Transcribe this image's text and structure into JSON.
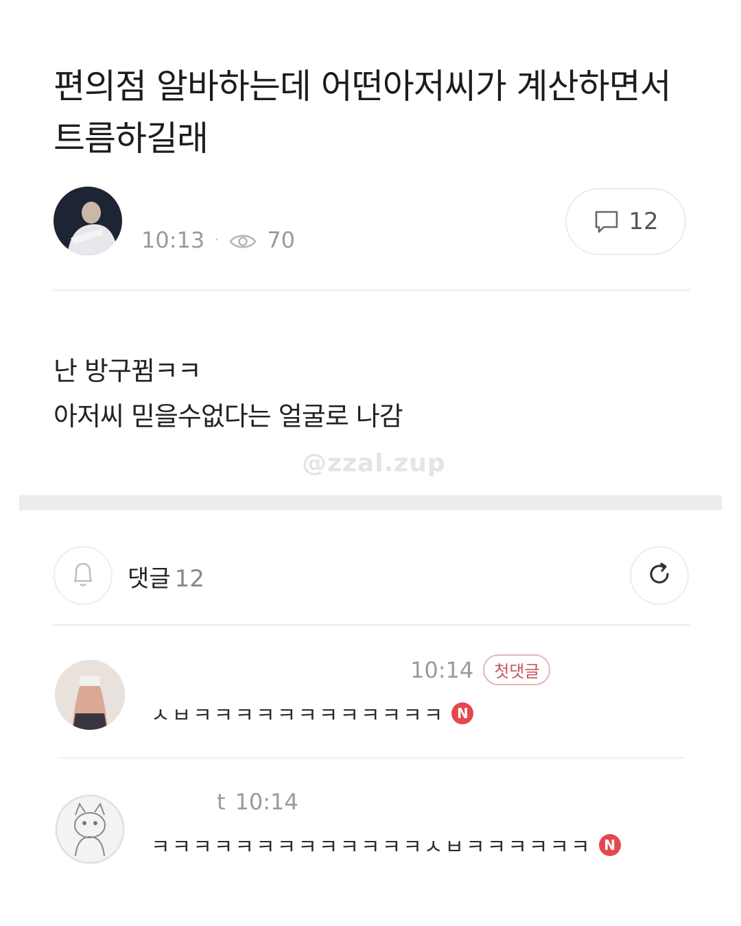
{
  "post": {
    "title": "편의점 알바하는데 어떤아저씨가 계산하면서 트름하길래",
    "time": "10:13",
    "views": "70",
    "comment_count": "12",
    "body_lines": [
      "난 방구뀜ㅋㅋ",
      "아저씨 믿을수없다는 얼굴로 나감"
    ],
    "watermark": "@zzal.zup"
  },
  "comments_header": {
    "label": "댓글",
    "count": "12"
  },
  "comments": [
    {
      "author": "",
      "time": "10:14",
      "badge": "첫댓글",
      "text": "ㅅㅂㅋㅋㅋㅋㅋㅋㅋㅋㅋㅋㅋㅋ",
      "new_mark": "N"
    },
    {
      "author": "t",
      "time": "10:14",
      "text": "ㅋㅋㅋㅋㅋㅋㅋㅋㅋㅋㅋㅋㅋㅅㅂㅋㅋㅋㅋㅋㅋ",
      "new_mark": "N"
    }
  ],
  "colors": {
    "new_badge": "#e5474f",
    "first_badge_text": "#c8545c",
    "meta_gray": "#9a9a9a",
    "divider": "#eeeeee"
  },
  "icons": {
    "views": "eye-icon",
    "comments": "speech-bubble-icon",
    "notify": "bell-icon",
    "refresh": "refresh-icon"
  }
}
